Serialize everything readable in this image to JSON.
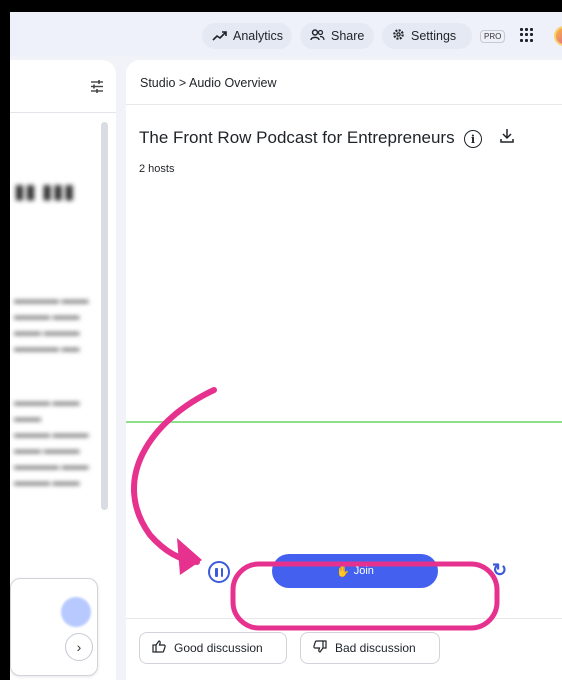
{
  "topbar": {
    "analytics_label": "Analytics",
    "share_label": "Share",
    "settings_label": "Settings",
    "pro_badge": "PRO"
  },
  "studio": {
    "breadcrumb": "Studio > Audio Overview",
    "title": "The Front Row Podcast for Entrepreneurs",
    "hosts": "2 hosts",
    "join_label": "Join",
    "good_label": "Good discussion",
    "bad_label": "Bad discussion"
  },
  "colors": {
    "accent": "#4361ee",
    "annotation": "#e7318f",
    "waveform": "#8de08a"
  }
}
